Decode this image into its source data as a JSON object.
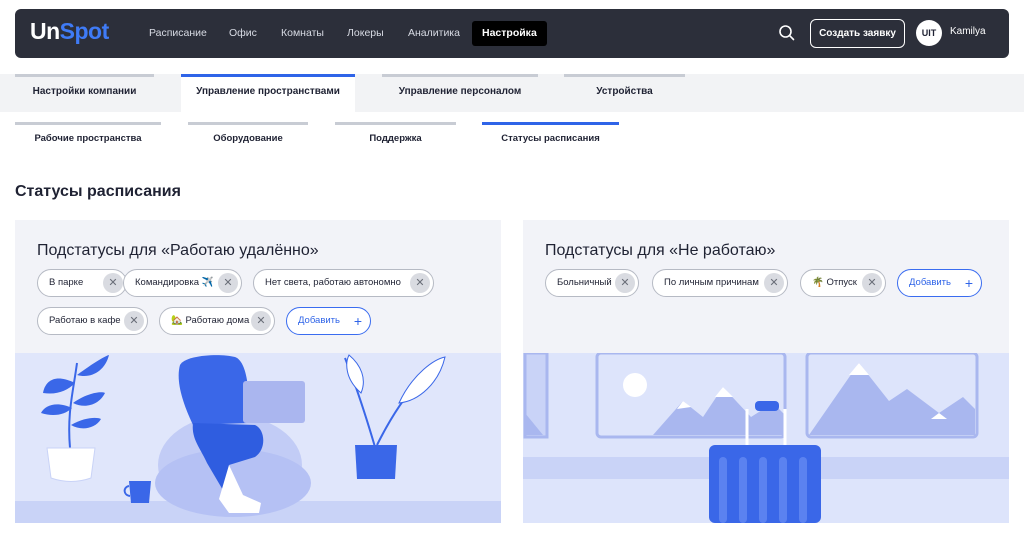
{
  "header": {
    "logo_part1": "Un",
    "logo_part2": "Spot",
    "nav": [
      "Расписание",
      "Офис",
      "Комнаты",
      "Локеры",
      "Аналитика",
      "Настройка"
    ],
    "active_nav": "Настройка",
    "create_label": "Создать заявку",
    "avatar_text": "UIT",
    "user_name": "Kamilya"
  },
  "primary_tabs": [
    "Настройки компании",
    "Управление пространствами",
    "Управление персоналом",
    "Устройства"
  ],
  "secondary_tabs": [
    "Рабочие пространства",
    "Оборудование",
    "Поддержка",
    "Статусы расписания"
  ],
  "page_title": "Статусы расписания",
  "cards": {
    "remote": {
      "title": "Подстатусы для «Работаю удалённо»",
      "chips": [
        "В парке",
        "Командировка ✈️",
        "Нет света, работаю автономно",
        "Работаю в кафе",
        "🏡 Работаю дома"
      ],
      "add_label": "Добавить"
    },
    "not_working": {
      "title": "Подстатусы для «Не работаю»",
      "chips": [
        "Больничный",
        "По личным причинам",
        "🌴 Отпуск"
      ],
      "add_label": "Добавить"
    }
  },
  "colors": {
    "accent": "#2f64e8",
    "topbar": "#2c2f3a",
    "card_bg": "#f2f3f8",
    "illustration_light": "#e0e6fb",
    "illustration_blue": "#3a67e8"
  },
  "icons": [
    "search-icon",
    "close-icon",
    "plus-icon"
  ]
}
